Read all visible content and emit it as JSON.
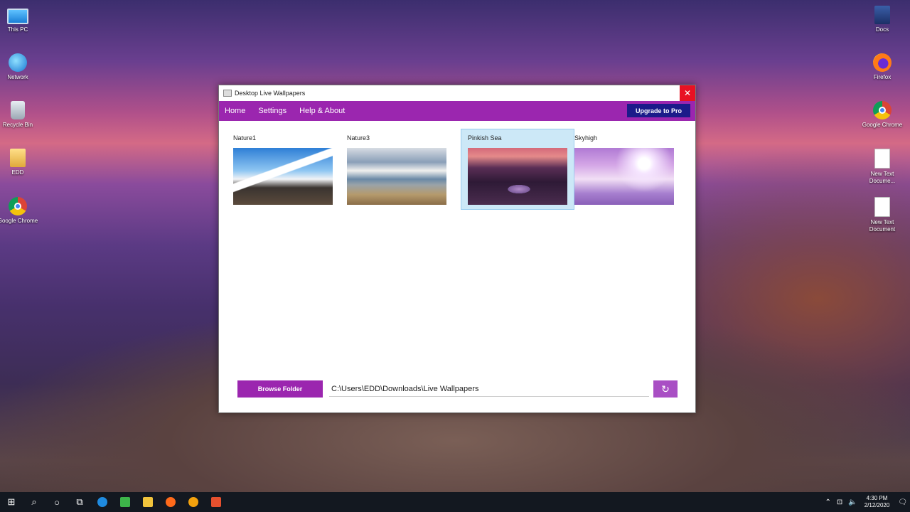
{
  "desktop": {
    "left_icons": [
      {
        "label": "This PC",
        "icon": "this-pc-icon"
      },
      {
        "label": "Network",
        "icon": "network-icon"
      },
      {
        "label": "Recycle Bin",
        "icon": "recycle-bin-icon"
      },
      {
        "label": "EDD",
        "icon": "user-folder-icon"
      },
      {
        "label": "Google Chrome",
        "icon": "chrome-icon"
      }
    ],
    "right_icons": [
      {
        "label": "Docs",
        "icon": "docs-icon"
      },
      {
        "label": "Firefox",
        "icon": "firefox-icon"
      },
      {
        "label": "Google Chrome",
        "icon": "chrome-icon"
      },
      {
        "label": "New Text Docume...",
        "icon": "text-document-icon"
      },
      {
        "label": "New Text Document",
        "icon": "text-document-icon"
      }
    ]
  },
  "window": {
    "title": "Desktop Live Wallpapers",
    "close_glyph": "✕",
    "menu": {
      "home": "Home",
      "settings": "Settings",
      "help": "Help & About",
      "upgrade": "Upgrade to Pro"
    },
    "wallpapers": [
      {
        "name": "Nature1",
        "selected": false
      },
      {
        "name": "Nature3",
        "selected": false
      },
      {
        "name": "Pinkish Sea",
        "selected": true
      },
      {
        "name": "Skyhigh",
        "selected": false
      }
    ],
    "browse_label": "Browse Folder",
    "folder_path": "C:\\Users\\EDD\\Downloads\\Live Wallpapers",
    "refresh_glyph": "↻",
    "accent_color": "#9b26af"
  },
  "taskbar": {
    "start_glyph": "⊞",
    "search_glyph": "⌕",
    "cortana_glyph": "○",
    "taskview_glyph": "⧉",
    "tray_glyphs": {
      "chevron": "⌃",
      "network": "⊡",
      "volume": "🔈",
      "notifications": "🗨"
    },
    "time": "4:30 PM",
    "date": "2/12/2020"
  }
}
